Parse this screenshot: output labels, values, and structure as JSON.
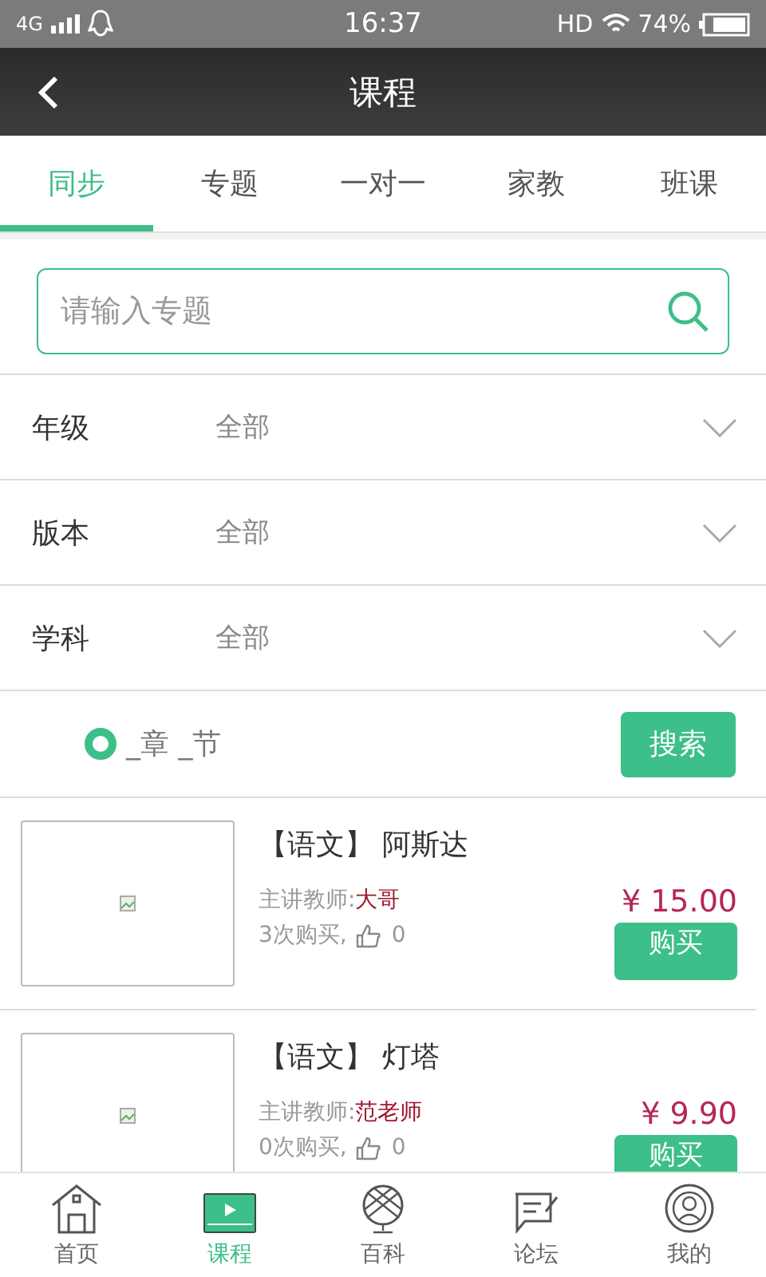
{
  "status_bar": {
    "network": "4G",
    "time": "16:37",
    "hd": "HD",
    "battery": "74%"
  },
  "title_bar": {
    "title": "课程"
  },
  "tabs": [
    {
      "label": "同步",
      "selected": true
    },
    {
      "label": "专题",
      "selected": false
    },
    {
      "label": "一对一",
      "selected": false
    },
    {
      "label": "家教",
      "selected": false
    },
    {
      "label": "班课",
      "selected": false
    }
  ],
  "search": {
    "placeholder": "请输入专题"
  },
  "filters": [
    {
      "label": "年级",
      "value": "全部"
    },
    {
      "label": "版本",
      "value": "全部"
    },
    {
      "label": "学科",
      "value": "全部"
    }
  ],
  "chapter": {
    "label": "_章 _节",
    "selected": true,
    "button": "搜索"
  },
  "courses": [
    {
      "subject": "【语文】",
      "title": "阿斯达",
      "teacher_label": "主讲教师:",
      "teacher": "大哥",
      "purchases": "3次购买,",
      "likes": "0",
      "price": "¥ 15.00",
      "button": "购买"
    },
    {
      "subject": "【语文】",
      "title": "灯塔",
      "teacher_label": "主讲教师:",
      "teacher": "范老师",
      "purchases": "0次购买,",
      "likes": "0",
      "price": "¥ 9.90",
      "button": "购买"
    }
  ],
  "bottom_nav": [
    {
      "label": "首页",
      "selected": false
    },
    {
      "label": "课程",
      "selected": true
    },
    {
      "label": "百科",
      "selected": false
    },
    {
      "label": "论坛",
      "selected": false
    },
    {
      "label": "我的",
      "selected": false
    }
  ]
}
